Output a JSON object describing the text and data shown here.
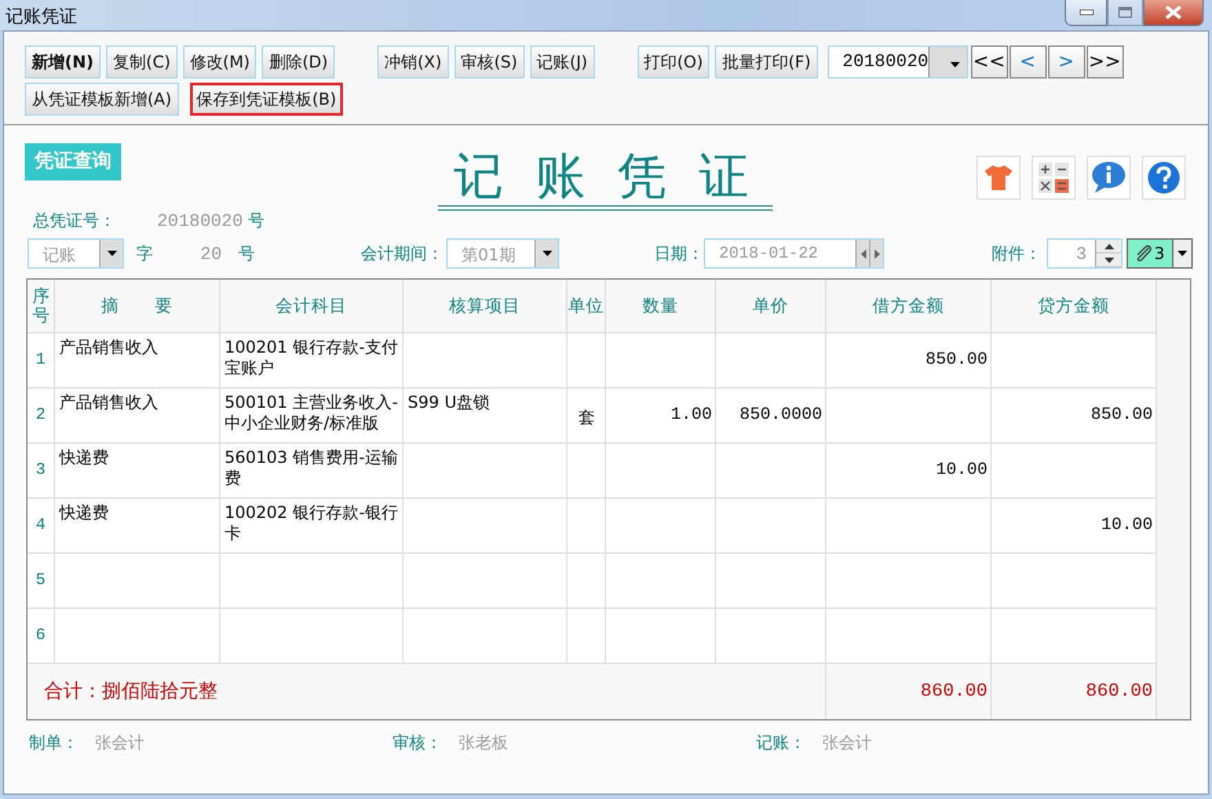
{
  "window": {
    "title": "记账凭证"
  },
  "toolbar": {
    "groups": [
      [
        {
          "label": "新增(N)",
          "default": true,
          "highlighted": false
        },
        {
          "label": "复制(C)",
          "default": false,
          "highlighted": false
        },
        {
          "label": "修改(M)",
          "default": false,
          "highlighted": false
        },
        {
          "label": "删除(D)",
          "default": false,
          "highlighted": false
        }
      ],
      [
        {
          "label": "冲销(X)",
          "default": false,
          "highlighted": false
        },
        {
          "label": "审核(S)",
          "default": false,
          "highlighted": false
        },
        {
          "label": "记账(J)",
          "default": false,
          "highlighted": false
        }
      ],
      [
        {
          "label": "打印(O)",
          "default": false,
          "highlighted": false
        },
        {
          "label": "批量打印(F)",
          "default": false,
          "highlighted": false
        }
      ]
    ],
    "voucher_select": {
      "value": "20180020"
    },
    "nav": [
      {
        "label": "<<",
        "color": "#000000"
      },
      {
        "label": "<",
        "color": "#0a78d2"
      },
      {
        "label": ">",
        "color": "#0a78d2"
      },
      {
        "label": ">>",
        "color": "#000000"
      }
    ],
    "second_row": [
      {
        "label": "从凭证模板新增(A)",
        "default": false,
        "highlighted": false
      },
      {
        "label": "保存到凭证模板(B)",
        "default": false,
        "highlighted": true
      }
    ]
  },
  "header": {
    "badge": "凭证查询",
    "title": "记 账 凭 证"
  },
  "fields": {
    "total_no": {
      "label": "总凭证号：",
      "value": "20180020",
      "unit": "号"
    },
    "word": {
      "value": "记账",
      "disabled": true,
      "label": "字",
      "number": "20",
      "unit": "号"
    },
    "period": {
      "label": "会计期间：",
      "value": "第01期",
      "disabled": true
    },
    "date": {
      "label": "日期：",
      "value": "2018-01-22",
      "disabled": true
    },
    "attachments": {
      "label": "附件：",
      "value": "3",
      "disabled": true,
      "count": "3"
    }
  },
  "table": {
    "columns": [
      "序号",
      "摘　　要",
      "会计科目",
      "核算项目",
      "单位",
      "数量",
      "单价",
      "借方金额",
      "贷方金额"
    ],
    "rows": [
      {
        "no": "1",
        "summary": "产品销售收入",
        "account": "100201 银行存款-支付宝账户",
        "debit": "850.00"
      },
      {
        "no": "2",
        "summary": "产品销售收入",
        "account": "500101 主营业务收入-中小企业财务/标准版",
        "project": "S99 U盘锁",
        "unit": "套",
        "qty": "1.00",
        "price": "850.0000",
        "credit": "850.00"
      },
      {
        "no": "3",
        "summary": "快递费",
        "account": "560103 销售费用-运输费",
        "debit": "10.00"
      },
      {
        "no": "4",
        "summary": "快递费",
        "account": "100202 银行存款-银行卡",
        "credit": "10.00"
      },
      {
        "no": "5"
      },
      {
        "no": "6"
      }
    ],
    "total": {
      "label": "合计：捌佰陆拾元整",
      "debit": "860.00",
      "credit": "860.00"
    }
  },
  "signatures": [
    {
      "label": "制单：",
      "name": "张会计"
    },
    {
      "label": "审核：",
      "name": "张老板"
    },
    {
      "label": "记账：",
      "name": "张会计"
    }
  ]
}
